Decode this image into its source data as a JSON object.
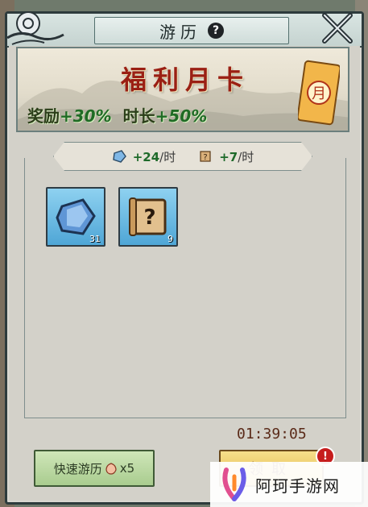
{
  "header": {
    "title": "游历",
    "help_glyph": "?",
    "close_icon": "close-x-icon"
  },
  "banner": {
    "title": "福利月卡",
    "reward_label": "奖励",
    "reward_value": "+30%",
    "duration_label": "时长",
    "duration_value": "+50%",
    "card_glyph": "月"
  },
  "rates": [
    {
      "icon": "crystal-icon",
      "amount": "+24",
      "unit": "/时"
    },
    {
      "icon": "scroll-icon",
      "amount": "+7",
      "unit": "/时"
    }
  ],
  "items": [
    {
      "icon": "crystal-icon",
      "count": "31"
    },
    {
      "icon": "mystery-scroll-icon",
      "count": "9"
    }
  ],
  "timer": "01:39:05",
  "buttons": {
    "quick_travel_label": "快速游历",
    "quick_travel_multiplier": "x5",
    "claim_label": "领取",
    "alert_glyph": "!"
  },
  "watermark": {
    "text": "阿珂手游网"
  },
  "colors": {
    "banner_title": "#9a1f14",
    "bonus_green": "#1f6b25",
    "timer": "#5a2a18",
    "panel_bg": "#d3d1c9"
  }
}
